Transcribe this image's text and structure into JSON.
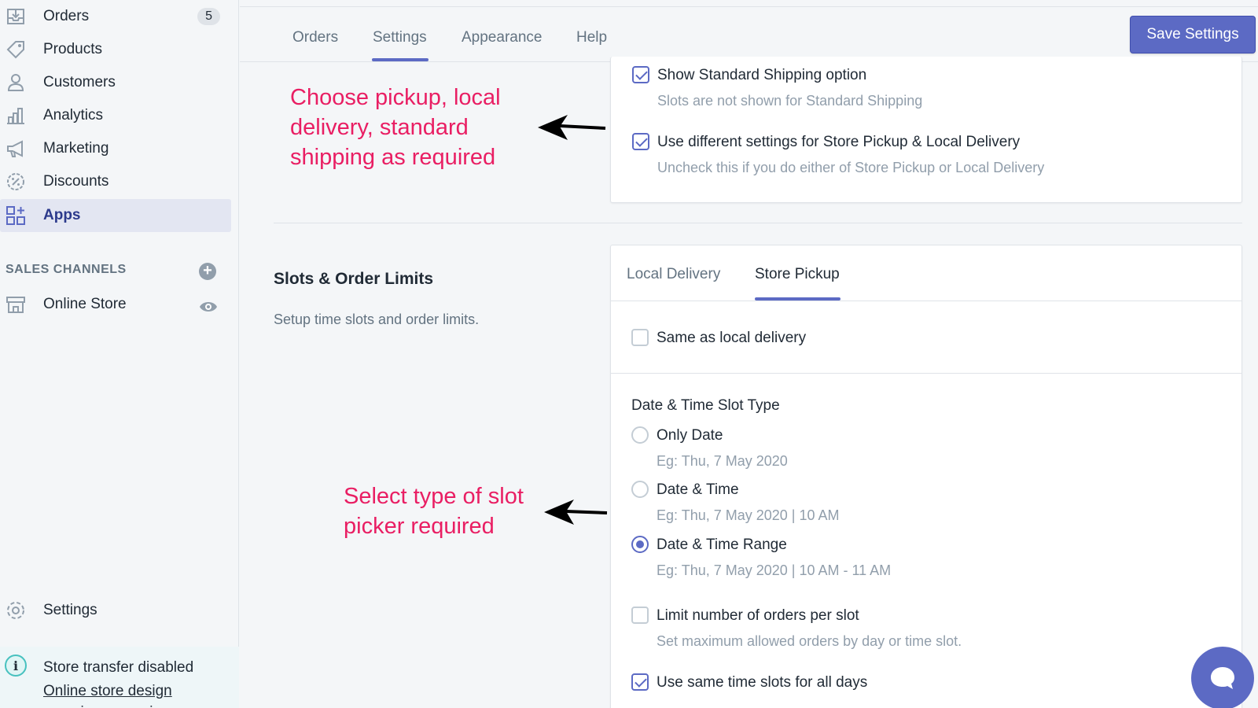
{
  "sidebar": {
    "items": [
      {
        "label": "Orders",
        "icon": "inbox-icon",
        "badge": "5"
      },
      {
        "label": "Products",
        "icon": "tag-icon"
      },
      {
        "label": "Customers",
        "icon": "person-icon"
      },
      {
        "label": "Analytics",
        "icon": "bar-chart-icon"
      },
      {
        "label": "Marketing",
        "icon": "megaphone-icon"
      },
      {
        "label": "Discounts",
        "icon": "discount-icon"
      },
      {
        "label": "Apps",
        "icon": "apps-icon",
        "active": true
      }
    ],
    "sales_channels_heading": "SALES CHANNELS",
    "online_store": "Online Store",
    "settings": "Settings",
    "footer_title": "Store transfer disabled",
    "footer_link": "Online store design experience preview"
  },
  "top_tabs": [
    "Orders",
    "Settings",
    "Appearance",
    "Help"
  ],
  "active_top_tab": "Settings",
  "save_button": "Save Settings",
  "shipping_card": {
    "show_standard": "Show Standard Shipping option",
    "show_standard_help": "Slots are not shown for Standard Shipping",
    "different_settings": "Use different settings for Store Pickup & Local Delivery",
    "different_settings_help": "Uncheck this if you do either of Store Pickup or Local Delivery"
  },
  "annotations": {
    "first": [
      "Choose pickup, local",
      "delivery, standard",
      "shipping as required"
    ],
    "second": [
      "Select type of slot",
      "picker required"
    ]
  },
  "slots_section": {
    "title": "Slots & Order Limits",
    "description": "Setup time slots and order limits."
  },
  "slots_card": {
    "tabs": [
      "Local Delivery",
      "Store Pickup"
    ],
    "active_tab": "Store Pickup",
    "same_as_local": "Same as local delivery",
    "slot_type_heading": "Date & Time Slot Type",
    "options": [
      {
        "label": "Only Date",
        "example": "Eg: Thu, 7 May 2020",
        "selected": false
      },
      {
        "label": "Date & Time",
        "example": "Eg: Thu, 7 May 2020 | 10 AM",
        "selected": false
      },
      {
        "label": "Date & Time Range",
        "example": "Eg: Thu, 7 May 2020 | 10 AM - 11 AM",
        "selected": true
      }
    ],
    "limit_orders": "Limit number of orders per slot",
    "limit_orders_help": "Set maximum allowed orders by day or time slot.",
    "same_time_slots": "Use same time slots for all days"
  },
  "colors": {
    "accent": "#5c6ac4",
    "annotation": "#e91e63"
  }
}
